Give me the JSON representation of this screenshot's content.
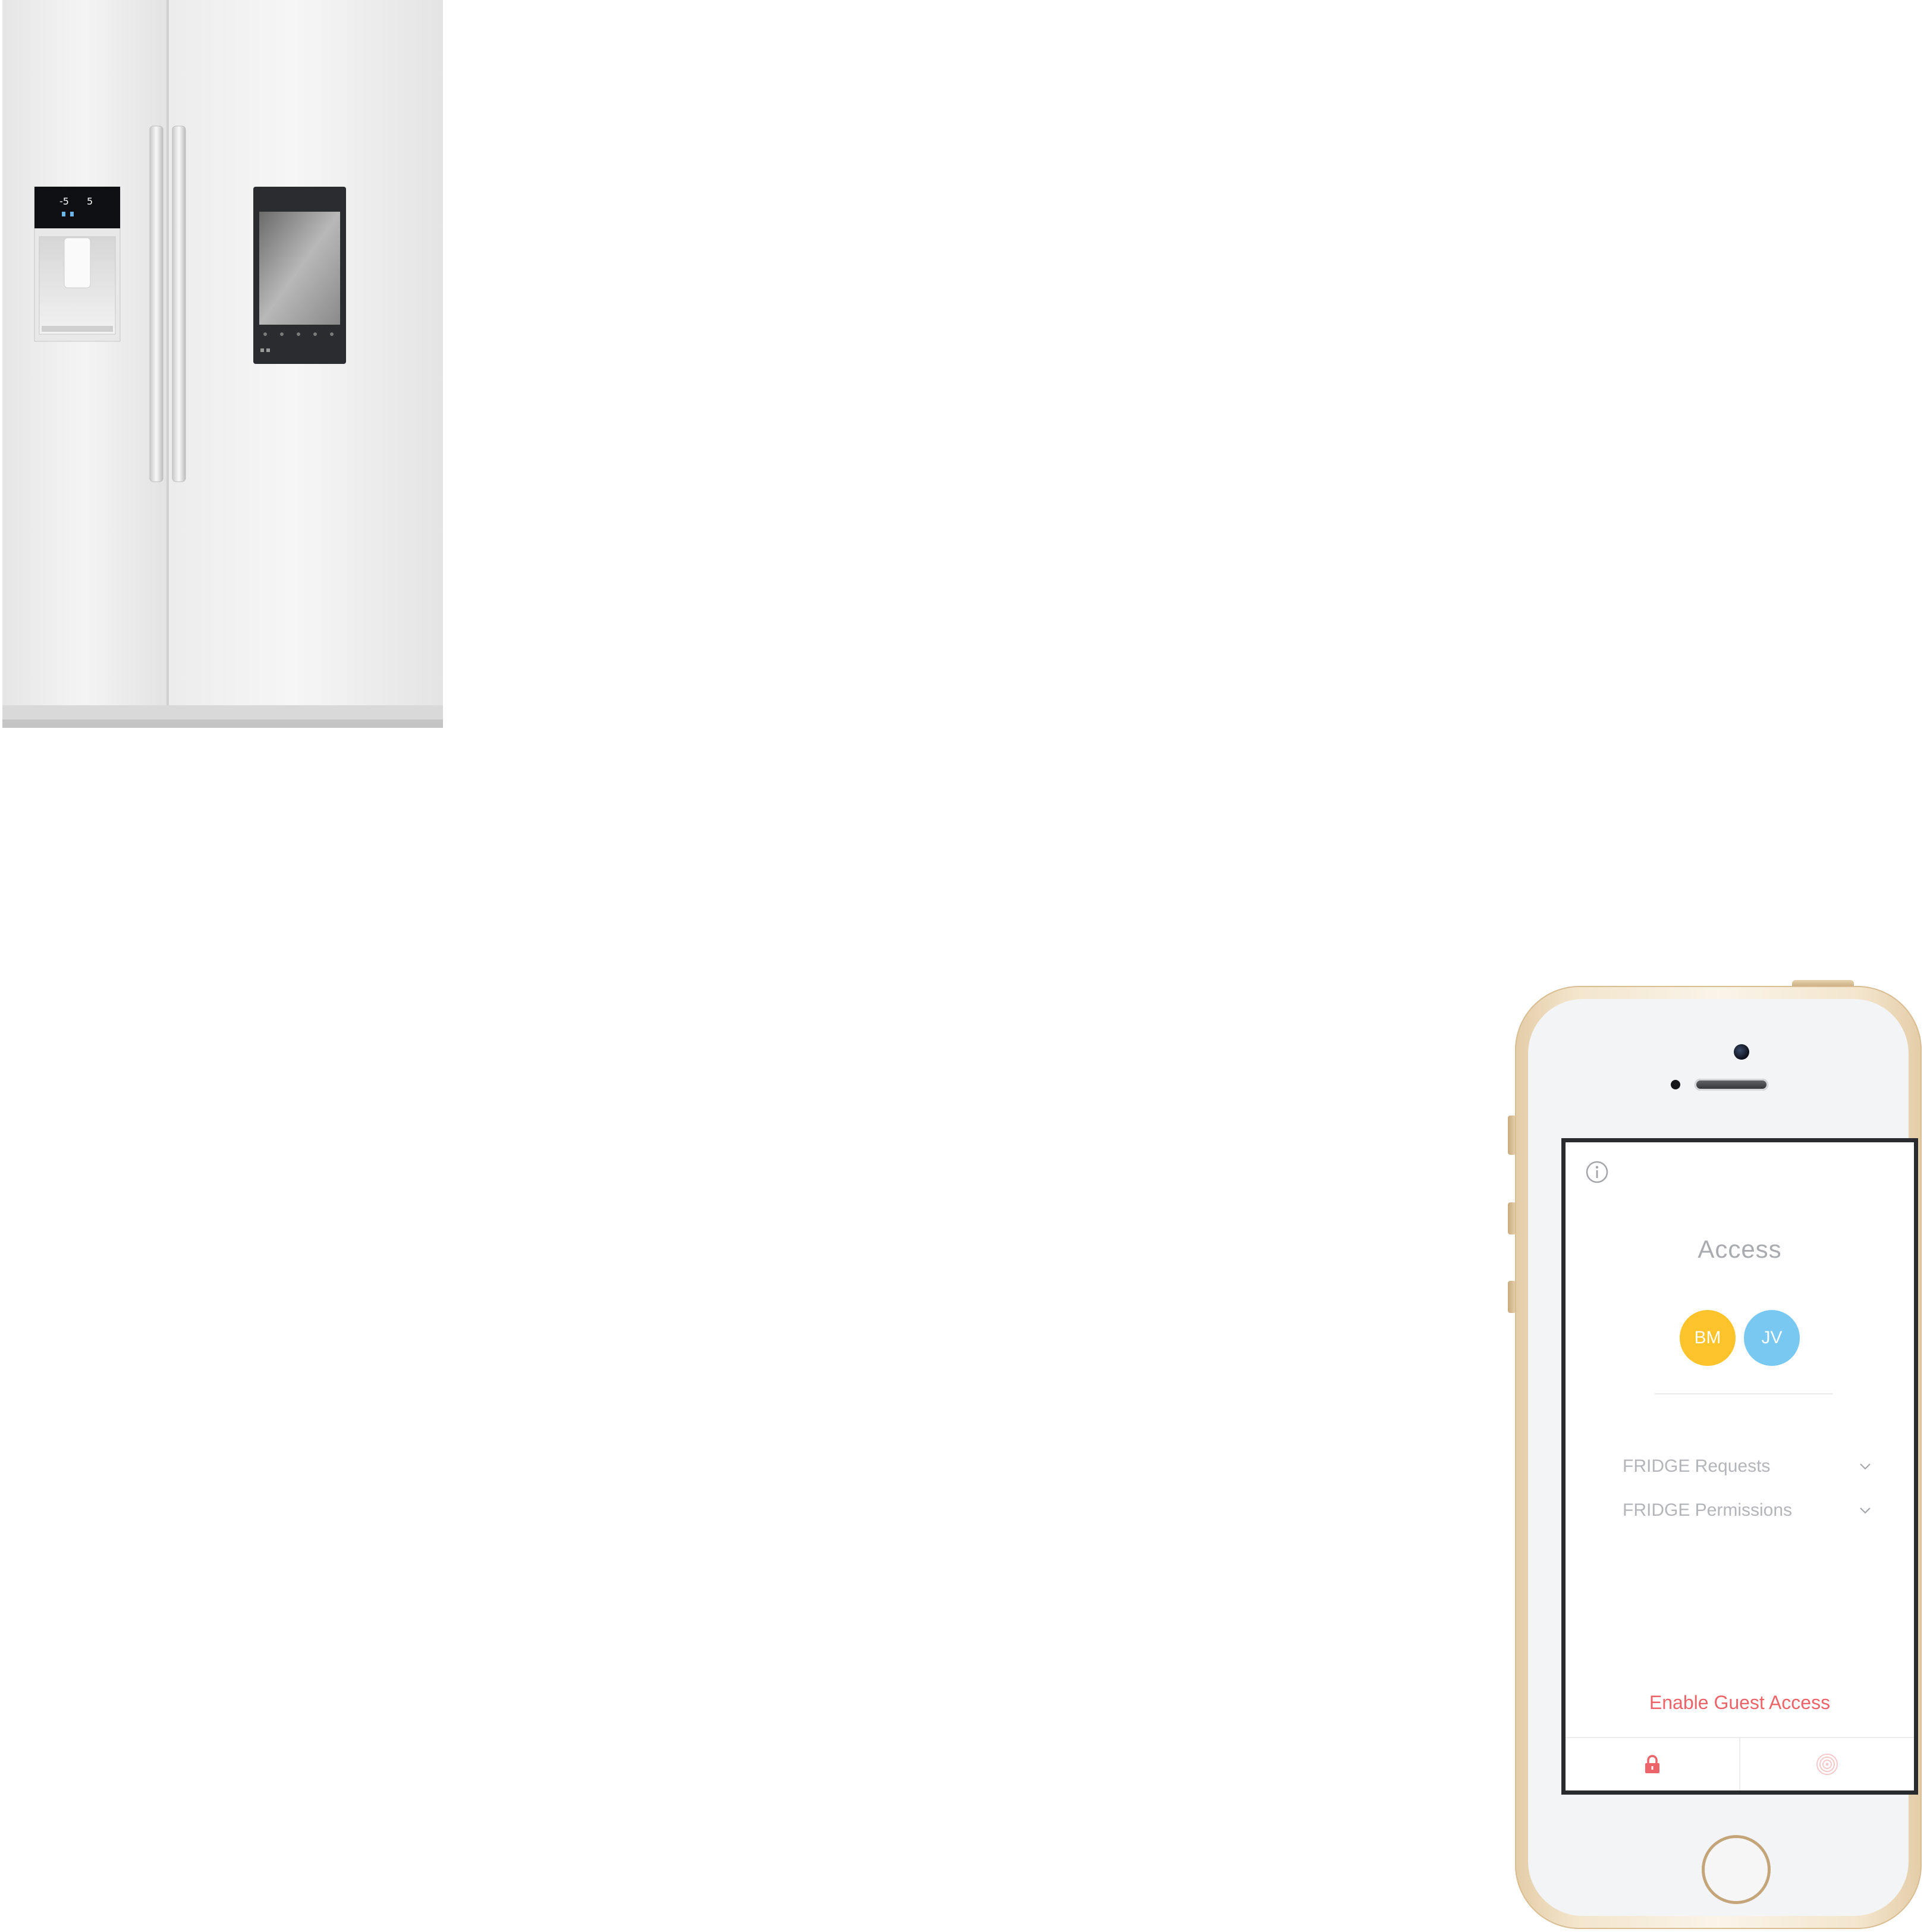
{
  "screen": {
    "title": "Access",
    "info_icon": "info-icon",
    "users": [
      {
        "initials": "BM",
        "color": "#fcc42a"
      },
      {
        "initials": "JV",
        "color": "#78c8f2"
      }
    ],
    "menu": [
      {
        "label": "FRIDGE Requests",
        "icon": "chevron-down-icon"
      },
      {
        "label": "FRIDGE Permissions",
        "icon": "chevron-down-icon"
      }
    ],
    "guest_access_label": "Enable Guest Access",
    "tabs": [
      {
        "icon": "lock-icon",
        "color": "#ec6469"
      },
      {
        "icon": "fingerprint-icon",
        "color": "#f7c8ca"
      }
    ]
  },
  "colors": {
    "accent": "#ec6469",
    "text_muted": "#a9abaf",
    "phone_gold": "#e4cda8"
  }
}
